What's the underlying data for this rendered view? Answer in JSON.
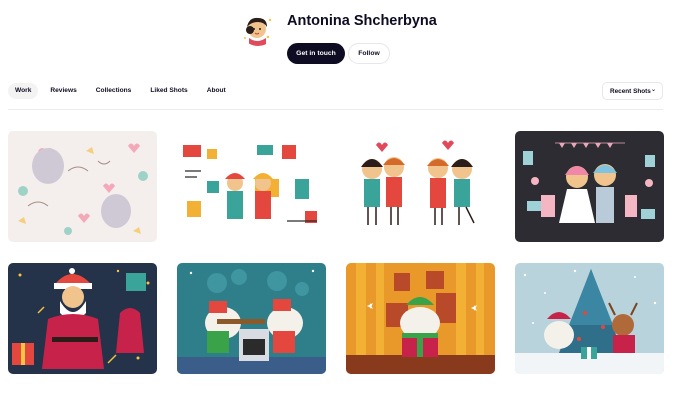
{
  "profile": {
    "name": "Antonina Shcherbyna",
    "get_in_touch_label": "Get in touch",
    "follow_label": "Follow"
  },
  "tabs": [
    {
      "label": "Work",
      "active": true
    },
    {
      "label": "Reviews",
      "active": false
    },
    {
      "label": "Collections",
      "active": false
    },
    {
      "label": "Liked Shots",
      "active": false
    },
    {
      "label": "About",
      "active": false
    }
  ],
  "sort": {
    "selected": "Recent Shots",
    "icon": "chevron-down-icon"
  },
  "shots": [
    {
      "subject": "cats-cupid-pattern"
    },
    {
      "subject": "construction-workers-tools"
    },
    {
      "subject": "couples-with-hearts"
    },
    {
      "subject": "wedding-couple-dark"
    },
    {
      "subject": "santa-claus"
    },
    {
      "subject": "sheep-bakers-kitchen"
    },
    {
      "subject": "sheep-gift-box"
    },
    {
      "subject": "sheep-reindeer-christmas-tree"
    }
  ],
  "colors": {
    "text": "#0d0c22",
    "primary_button": "#0d0c22",
    "active_tab": "#f3f3f4",
    "border": "#e7e7e9"
  }
}
